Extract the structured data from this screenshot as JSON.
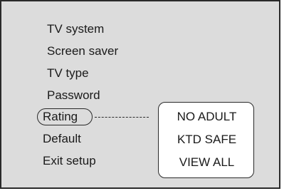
{
  "menu": {
    "items": [
      "TV system",
      "Screen saver",
      "TV type",
      "Password",
      "Rating",
      "Default",
      "Exit setup"
    ],
    "selected": "Rating"
  },
  "rating_options": [
    "NO ADULT",
    "KTD SAFE",
    "VIEW ALL"
  ]
}
